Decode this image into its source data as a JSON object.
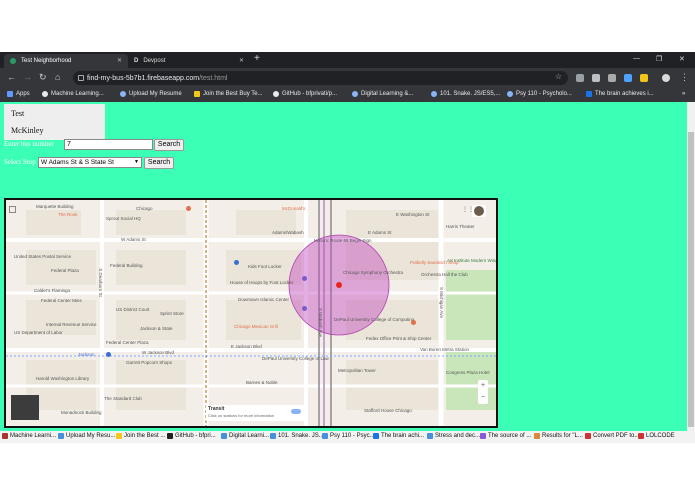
{
  "browser": {
    "tabs": [
      {
        "title": "Test Neighborhood",
        "active": true
      },
      {
        "title": "Devpost",
        "active": false
      }
    ],
    "url_host": "find-my-bus-5b7b1.firebaseapp.com",
    "url_path": "/test.html",
    "new_tab": "+",
    "win_min": "—",
    "win_max": "❐",
    "win_close": "✕"
  },
  "bookmarks": [
    {
      "label": "Apps",
      "color": "#5f9bff"
    },
    {
      "label": "Machine Learning...",
      "color": "#e8eaed"
    },
    {
      "label": "Upload My Resume",
      "color": "#8ab4f8"
    },
    {
      "label": "Join the Best Buy Te...",
      "color": "#f5c518"
    },
    {
      "label": "GitHub - bfprivati/p...",
      "color": "#e8eaed"
    },
    {
      "label": "Digital Learning &...",
      "color": "#8ab4f8"
    },
    {
      "label": "101. Snake. JS/ES5,...",
      "color": "#8ab4f8"
    },
    {
      "label": "Psy 110 - Psycholo...",
      "color": "#8ab4f8"
    },
    {
      "label": "The brain achieves i...",
      "color": "#1a73e8"
    }
  ],
  "page": {
    "list_items": [
      "Test",
      "McKinley"
    ],
    "bus_label": "Enter bus number",
    "bus_value": "7",
    "search_label": "Search",
    "stop_label": "Select Stop",
    "stop_value": "W Adams St & S State St",
    "search2_label": "Search"
  },
  "map": {
    "labels": [
      "Marquette Building",
      "The Rook",
      "Sprout Social HQ",
      "Chicago",
      "McDonald's",
      "Adams/Wabash",
      "Historic Route 66 Begin Sign",
      "E Adams St",
      "W Adams St",
      "Potbelly Sandwich Shop",
      "Chicago Symphony Orchestra",
      "Orchestra Hall the Club",
      "United States Postal Service",
      "Federal Building",
      "Kids Foot Locker",
      "Federal Plaza",
      "House of Hoops by Foot Locker",
      "Calder's Flamingo",
      "Federal Center Mies",
      "Downtown Islamic Center",
      "Art Institute Modern Wing",
      "Internal Revenue Service",
      "US District Court",
      "Sprint Store",
      "Chicago Mexican Grill",
      "US Department of Labor",
      "Jackson & State",
      "DePaul University College of Computing",
      "Federal Center Plaza",
      "W Jackson Blvd",
      "E Jackson Blvd",
      "Jackson",
      "Garrett Popcorn Shops",
      "DePaul University College of Law",
      "Fedex Office Print & Ship Center",
      "Van Buren Metra Station",
      "Metropolitan Tower",
      "The Standard Club",
      "Barnes & Noble",
      "Stafford House Chicago",
      "Monadnock Building",
      "Harold Washington Library",
      "Harris Theater",
      "Transit",
      "Click on stations for more information",
      "E Washington St",
      "S Wabash Ave",
      "S Dearborn St",
      "S Michigan Ave",
      "Congress Plaza Hotel"
    ],
    "zoom_in": "+",
    "zoom_out": "−",
    "marker_color": "#e8241b",
    "circle_color": "#c24bc1"
  },
  "taskbar": [
    {
      "label": "Machine Learni...",
      "color": "#aa3333"
    },
    {
      "label": "Upload My Resu...",
      "color": "#4a90d9"
    },
    {
      "label": "Join the Best ...",
      "color": "#f5c518"
    },
    {
      "label": "GitHub - bfpri...",
      "color": "#222222"
    },
    {
      "label": "Digital Learni...",
      "color": "#4a90d9"
    },
    {
      "label": "101. Snake. JS...",
      "color": "#4a90d9"
    },
    {
      "label": "Psy 110 - Psyc...",
      "color": "#4a90d9"
    },
    {
      "label": "The brain achi...",
      "color": "#1a73e8"
    },
    {
      "label": "Stress and dec...",
      "color": "#4a90d9"
    },
    {
      "label": "The source of ...",
      "color": "#8a5ad9"
    },
    {
      "label": "Results for \"L...",
      "color": "#d98a3a"
    },
    {
      "label": "Convert PDF to...",
      "color": "#cc3333"
    },
    {
      "label": "LOLCODE",
      "color": "#cc3333"
    }
  ]
}
